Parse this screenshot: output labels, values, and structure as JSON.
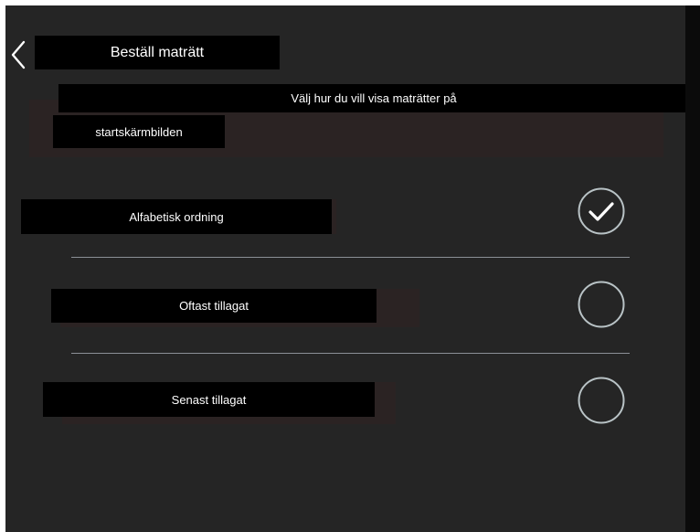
{
  "header": {
    "title": "Beställ maträtt",
    "back_icon": "chevron-left-icon"
  },
  "setting": {
    "subtitle": "Välj hur du vill visa maträtter på",
    "description": "startskärmbilden"
  },
  "options": [
    {
      "label": "Alfabetisk ordning",
      "selected": true
    },
    {
      "label": "Oftast tillagat",
      "selected": false
    },
    {
      "label": "Senast tillagat",
      "selected": false
    }
  ],
  "colors": {
    "background": "#252525",
    "label_background": "#000000",
    "text": "#ffffff",
    "radio_stroke": "#b9c3c6",
    "divider": "#8b8f96"
  }
}
